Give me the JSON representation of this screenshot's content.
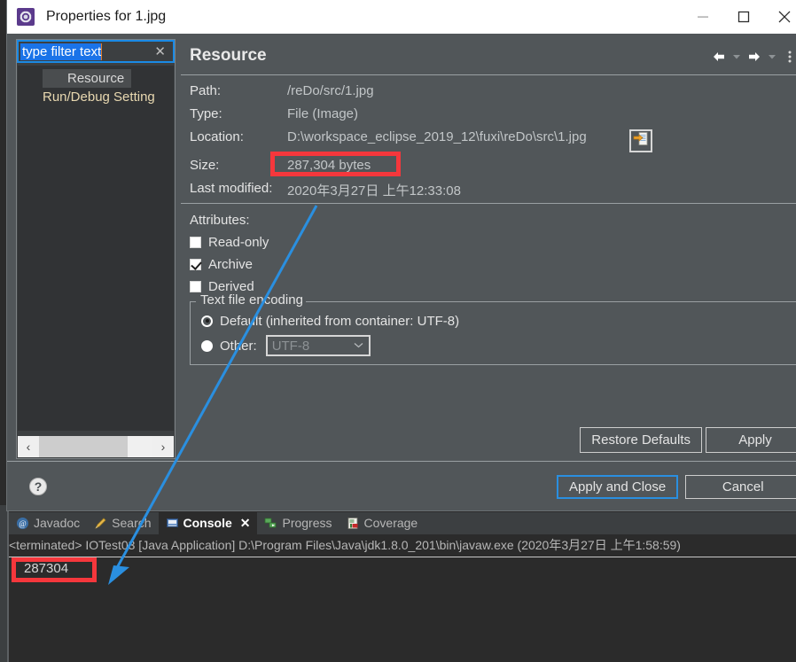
{
  "window": {
    "title": "Properties for 1.jpg",
    "app_icon": "eclipse-gear-icon",
    "minimize_label": "—",
    "maximize_label": "□",
    "close_label": "✕"
  },
  "sidebar": {
    "filter": {
      "value": "type filter text",
      "clear_label": "✕"
    },
    "items": [
      {
        "label": "Resource",
        "selected": true
      },
      {
        "label": "Run/Debug Setting",
        "selected": false
      }
    ],
    "hscroll": {
      "left_label": "‹",
      "right_label": "›"
    }
  },
  "page": {
    "title": "Resource",
    "toolbar": {
      "back_label": "←",
      "back_caret": "▼",
      "forward_label": "→",
      "forward_caret": "▼",
      "menu_label": "⋮"
    },
    "fields": [
      {
        "label": "Path:",
        "value": "/reDo/src/1.jpg"
      },
      {
        "label": "Type:",
        "value": "File  (Image)"
      },
      {
        "label": "Location:",
        "value": "D:\\workspace_eclipse_2019_12\\fuxi\\reDo\\src\\1.jpg"
      },
      {
        "label": "Size:",
        "value": "287,304  bytes"
      },
      {
        "label": "Last modified:",
        "value": "2020年3月27日 上午12:33:08"
      }
    ],
    "location_button_icon": "open-in-explorer-icon",
    "attributes": {
      "heading": "Attributes:",
      "items": [
        {
          "label": "Read-only",
          "checked": false,
          "accel": "R"
        },
        {
          "label": "Archive",
          "checked": true,
          "accel": "c"
        },
        {
          "label": "Derived",
          "checked": false,
          "accel": "v"
        }
      ]
    },
    "encoding": {
      "group_title": "Text file encoding",
      "default_option": "Default (inherited from container: UTF-8)",
      "other_option": "Other:",
      "other_selected": false,
      "default_selected": true,
      "combo_value": "UTF-8",
      "combo_caret": "⌄"
    },
    "buttons": {
      "restore_defaults": "Restore Defaults",
      "apply": "Apply"
    }
  },
  "dialog_footer": {
    "help_icon": "help-question-icon",
    "apply_and_close": "Apply and Close",
    "cancel": "Cancel"
  },
  "console": {
    "tabs": [
      {
        "label": "Javadoc",
        "icon": "javadoc-at-icon",
        "active": false
      },
      {
        "label": "Search",
        "icon": "search-pencil-icon",
        "active": false
      },
      {
        "label": "Console",
        "icon": "console-icon",
        "active": true,
        "close_label": "✕"
      },
      {
        "label": "Progress",
        "icon": "progress-icon",
        "active": false
      },
      {
        "label": "Coverage",
        "icon": "coverage-icon",
        "active": false
      }
    ],
    "header": "<terminated> IOTest03 [Java Application] D:\\Program Files\\Java\\jdk1.8.0_201\\bin\\javaw.exe (2020年3月27日 上午1:58:59)",
    "output": "287304"
  },
  "annotations": {
    "highlight_color": "#f5373c",
    "arrow_color": "#2a8fe0",
    "boxes": [
      {
        "target": "size-value"
      },
      {
        "target": "console-output"
      }
    ]
  }
}
